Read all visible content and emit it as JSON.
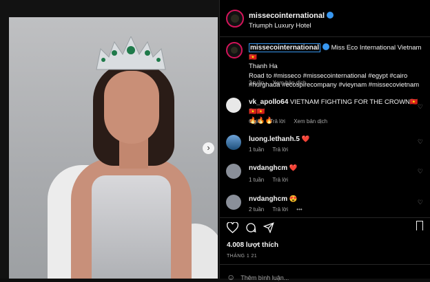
{
  "post": {
    "account": "missecointernational",
    "location": "Triumph Luxury Hotel",
    "caption_user": "missecointernational",
    "caption_line1": "Miss Eco International Vietnam",
    "caption_flag": "🇻🇳",
    "caption_line2": "Thanh Ha",
    "caption_hashtags": "Road to #misseco #missecointernational #egypt #cairo #hurghada #ecospirecompany #vieynam #missecovietnam",
    "caption_time": "3 tuần",
    "see_translation": "Xem bản dịch",
    "likes": "4.008 lượt thích",
    "date": "THÁNG 1 21",
    "add_comment_placeholder": "Thêm bình luận..."
  },
  "comments": [
    {
      "user": "vk_apollo64",
      "text": "VIETNAM FIGHTING FOR THE CROWN🇻🇳🇻🇳🇻🇳",
      "text2": "🔥🔥🔥",
      "time": "6 giờ",
      "reply": "Trả lời",
      "translate": "Xem bản dịch"
    },
    {
      "user": "luong.lethanh.5",
      "text": "❤️",
      "time": "1 tuần",
      "reply": "Trả lời"
    },
    {
      "user": "nvdanghcm",
      "text": "❤️",
      "time": "1 tuần",
      "reply": "Trả lời"
    },
    {
      "user": "nvdanghcm",
      "text": "😍",
      "time": "2 tuần",
      "reply": "Trả lời",
      "more": "•••"
    }
  ],
  "icons": {
    "next": "chevron-right-icon",
    "like": "heart-icon",
    "comment": "comment-icon",
    "share": "share-icon",
    "save": "bookmark-icon"
  },
  "colors": {
    "background": "#000000",
    "verified": "#3897f0",
    "avatar_ring": "#d4145a"
  }
}
